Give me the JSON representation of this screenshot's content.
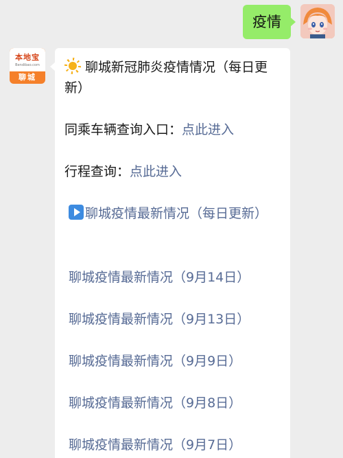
{
  "user_message": {
    "text": "疫情"
  },
  "bot": {
    "avatar": {
      "logo_text": "本地宝",
      "domain_text": "Bendibao.com",
      "city_text": "聊城"
    },
    "card": {
      "title_icon": "sun-icon",
      "title": "聊城新冠肺炎疫情情况（每日更新）",
      "ride_query_label": "同乘车辆查询入口：",
      "ride_query_link": "点此进入",
      "trip_query_label": "行程查询：",
      "trip_query_link": "点此进入",
      "latest_icon": "play-icon",
      "latest_link": "聊城疫情最新情况（每日更新）",
      "daily_links": [
        "聊城疫情最新情况（9月14日）",
        "聊城疫情最新情况（9月13日）",
        "聊城疫情最新情况（9月9日）",
        "聊城疫情最新情况（9月8日）",
        "聊城疫情最新情况（9月7日）"
      ]
    }
  },
  "colors": {
    "background": "#ededed",
    "user_bubble": "#95ec69",
    "link": "#576b95",
    "bot_avatar": "#f5802a"
  }
}
